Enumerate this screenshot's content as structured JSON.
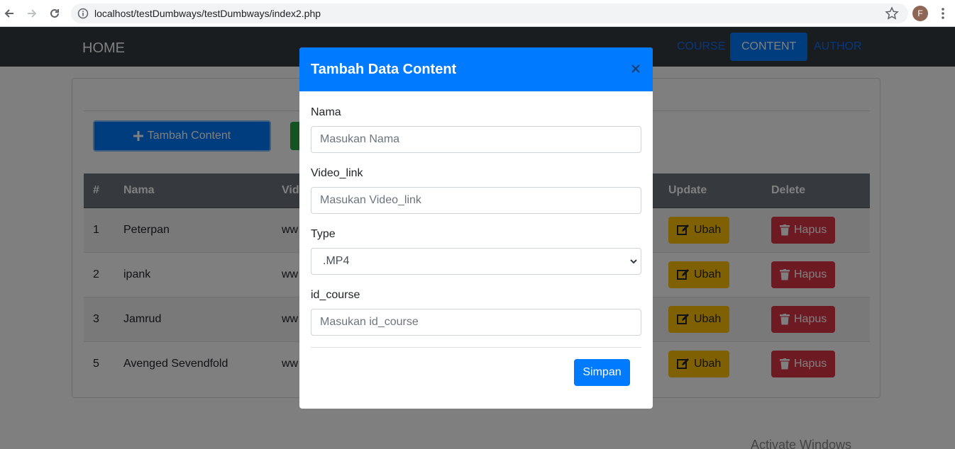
{
  "browser": {
    "url": "localhost/testDumbways/testDumbways/index2.php",
    "avatar_letter": "F"
  },
  "navbar": {
    "brand": "HOME",
    "links": [
      {
        "label": "COURSE",
        "active": false
      },
      {
        "label": "CONTENT",
        "active": true
      },
      {
        "label": "AUTHOR",
        "active": false
      }
    ]
  },
  "toolbar": {
    "add_label": "Tambah Content"
  },
  "table": {
    "headers": [
      "#",
      "Nama",
      "Vid",
      "Update",
      "Delete"
    ],
    "rows": [
      {
        "num": "1",
        "nama": "Peterpan",
        "video": "ww"
      },
      {
        "num": "2",
        "nama": "ipank",
        "video": "ww"
      },
      {
        "num": "3",
        "nama": "Jamrud",
        "video": "ww"
      },
      {
        "num": "5",
        "nama": "Avenged Sevendfold",
        "video": "ww"
      }
    ],
    "ubah_label": "Ubah",
    "hapus_label": "Hapus"
  },
  "modal": {
    "title": "Tambah Data Content",
    "fields": {
      "nama": {
        "label": "Nama",
        "placeholder": "Masukan Nama"
      },
      "video_link": {
        "label": "Video_link",
        "placeholder": "Masukan Video_link"
      },
      "type": {
        "label": "Type",
        "selected": ".MP4"
      },
      "id_course": {
        "label": "id_course",
        "placeholder": "Masukan id_course"
      }
    },
    "save_label": "Simpan"
  },
  "watermark": "Activate Windows",
  "colors": {
    "primary": "#007bff",
    "warning": "#ffc107",
    "danger": "#dc3545",
    "navbar": "#343a40"
  }
}
